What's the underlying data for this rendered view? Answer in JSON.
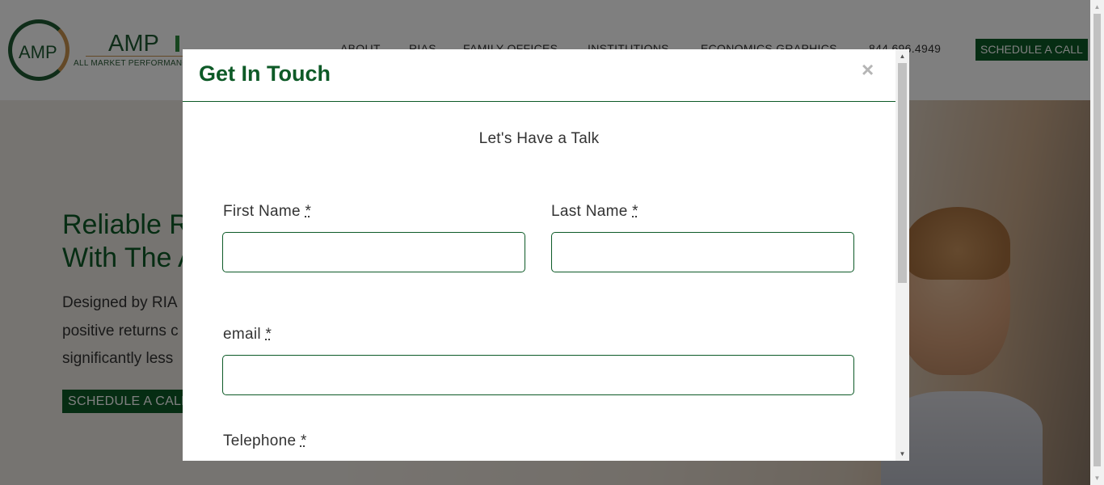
{
  "site": {
    "logo": {
      "mark": "AMP",
      "name": "AMP",
      "tagline": "ALL MARKET PERFORMANCE"
    },
    "nav": [
      {
        "label": "ABOUT"
      },
      {
        "label": "RIAS"
      },
      {
        "label": "FAMILY OFFICES"
      },
      {
        "label": "INSTITUTIONS"
      },
      {
        "label": "ECONOMICS GRAPHICS"
      },
      {
        "label": "844.696.4949"
      }
    ],
    "nav_cta": "SCHEDULE A CALL",
    "hero": {
      "title_line1": "Reliable R",
      "title_line2": "With The A",
      "text_line1": "Designed by RIA",
      "text_line2": "positive returns c",
      "text_line3": "significantly less",
      "cta": "SCHEDULE A CALL"
    }
  },
  "modal": {
    "title": "Get In Touch",
    "close_icon": "close-icon",
    "subtitle": "Let's Have a Talk",
    "fields": {
      "first_name": {
        "label": "First Name",
        "required": "*",
        "value": ""
      },
      "last_name": {
        "label": "Last Name",
        "required": "*",
        "value": ""
      },
      "email": {
        "label": "email",
        "required": "*",
        "value": ""
      },
      "telephone": {
        "label": "Telephone",
        "required": "*"
      }
    }
  },
  "icons": {
    "close": "×",
    "scroll_up": "▲",
    "scroll_down": "▼"
  },
  "colors": {
    "brand_green": "#0d5a27",
    "accent_gold": "#c8924f",
    "overlay": "rgba(0,0,0,0.5)"
  }
}
